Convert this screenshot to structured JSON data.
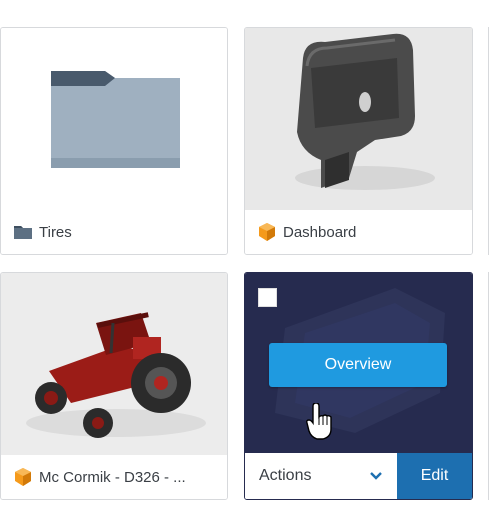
{
  "cards": [
    {
      "label": "Tires",
      "type_icon": "folder-icon"
    },
    {
      "label": "Dashboard",
      "type_icon": "part-cube-icon"
    },
    {
      "label": "Mc Cormik - D326 - ...",
      "type_icon": "part-cube-icon"
    },
    {
      "overview_label": "Overview",
      "actions_label": "Actions",
      "edit_label": "Edit"
    }
  ],
  "colors": {
    "accent_blue": "#1f9ae0",
    "edit_blue": "#1d6fb0",
    "hover_overlay": "#262b4f",
    "part_icon_orange": "#f59a1b",
    "folder_gray": "#5d7083"
  }
}
